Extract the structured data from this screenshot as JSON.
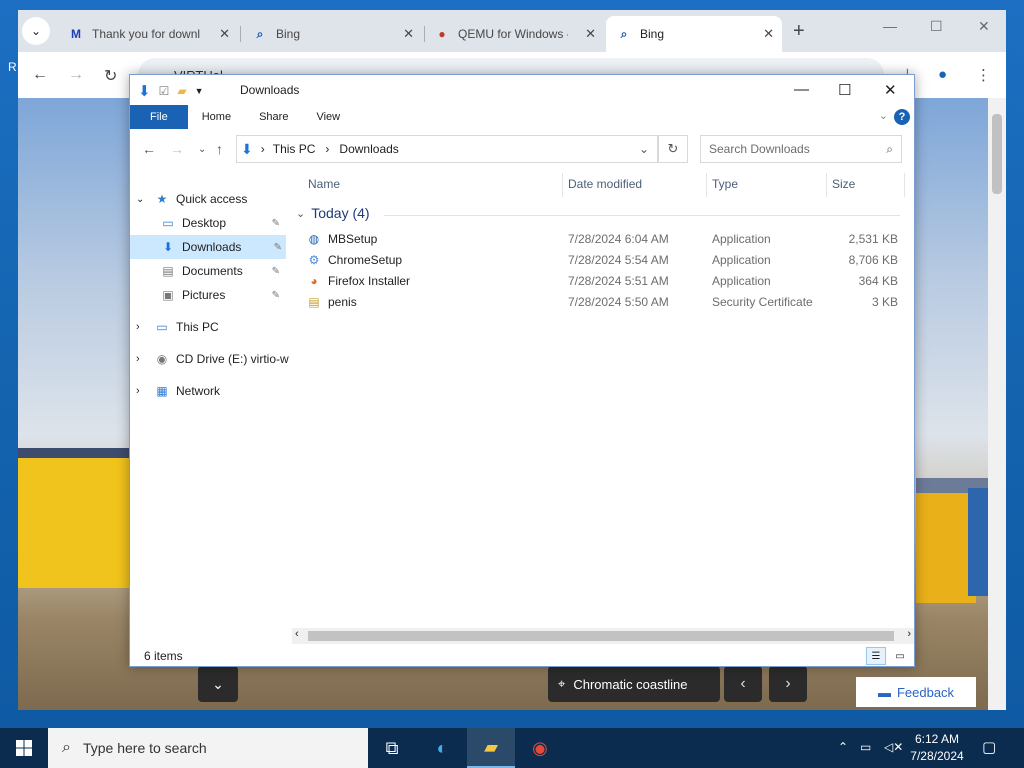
{
  "desktop": {
    "edge_letter": "R"
  },
  "browser": {
    "tabs": [
      {
        "label": "Thank you for downl",
        "favicon": "M",
        "active": false
      },
      {
        "label": "Bing",
        "favicon": "search-icon",
        "active": false
      },
      {
        "label": "QEMU for Windows -",
        "favicon": "qemu-icon",
        "active": false
      },
      {
        "label": "Bing",
        "favicon": "search-icon",
        "active": true
      }
    ],
    "address": "VIRTUal",
    "page": {
      "location_label": "Chromatic coastline",
      "feedback_label": "Feedback"
    }
  },
  "explorer": {
    "title": "Downloads",
    "ribbon_tabs": [
      "File",
      "Home",
      "Share",
      "View"
    ],
    "breadcrumb": [
      "This PC",
      "Downloads"
    ],
    "search_placeholder": "Search Downloads",
    "nav": {
      "quick_access": "Quick access",
      "desktop": "Desktop",
      "downloads": "Downloads",
      "documents": "Documents",
      "pictures": "Pictures",
      "this_pc": "This PC",
      "cd_drive": "CD Drive (E:) virtio-w",
      "network": "Network"
    },
    "columns": {
      "name": "Name",
      "date": "Date modified",
      "type": "Type",
      "size": "Size"
    },
    "group": "Today (4)",
    "files": [
      {
        "name": "MBSetup",
        "date": "7/28/2024 6:04 AM",
        "type": "Application",
        "size": "2,531 KB",
        "icon": "installer-icon"
      },
      {
        "name": "ChromeSetup",
        "date": "7/28/2024 5:54 AM",
        "type": "Application",
        "size": "8,706 KB",
        "icon": "setup-icon"
      },
      {
        "name": "Firefox Installer",
        "date": "7/28/2024 5:51 AM",
        "type": "Application",
        "size": "364 KB",
        "icon": "firefox-icon"
      },
      {
        "name": "penis",
        "date": "7/28/2024 5:50 AM",
        "type": "Security Certificate",
        "size": "3 KB",
        "icon": "certificate-icon"
      }
    ],
    "status": "6 items"
  },
  "taskbar": {
    "search_placeholder": "Type here to search",
    "time": "6:12 AM",
    "date": "7/28/2024"
  }
}
